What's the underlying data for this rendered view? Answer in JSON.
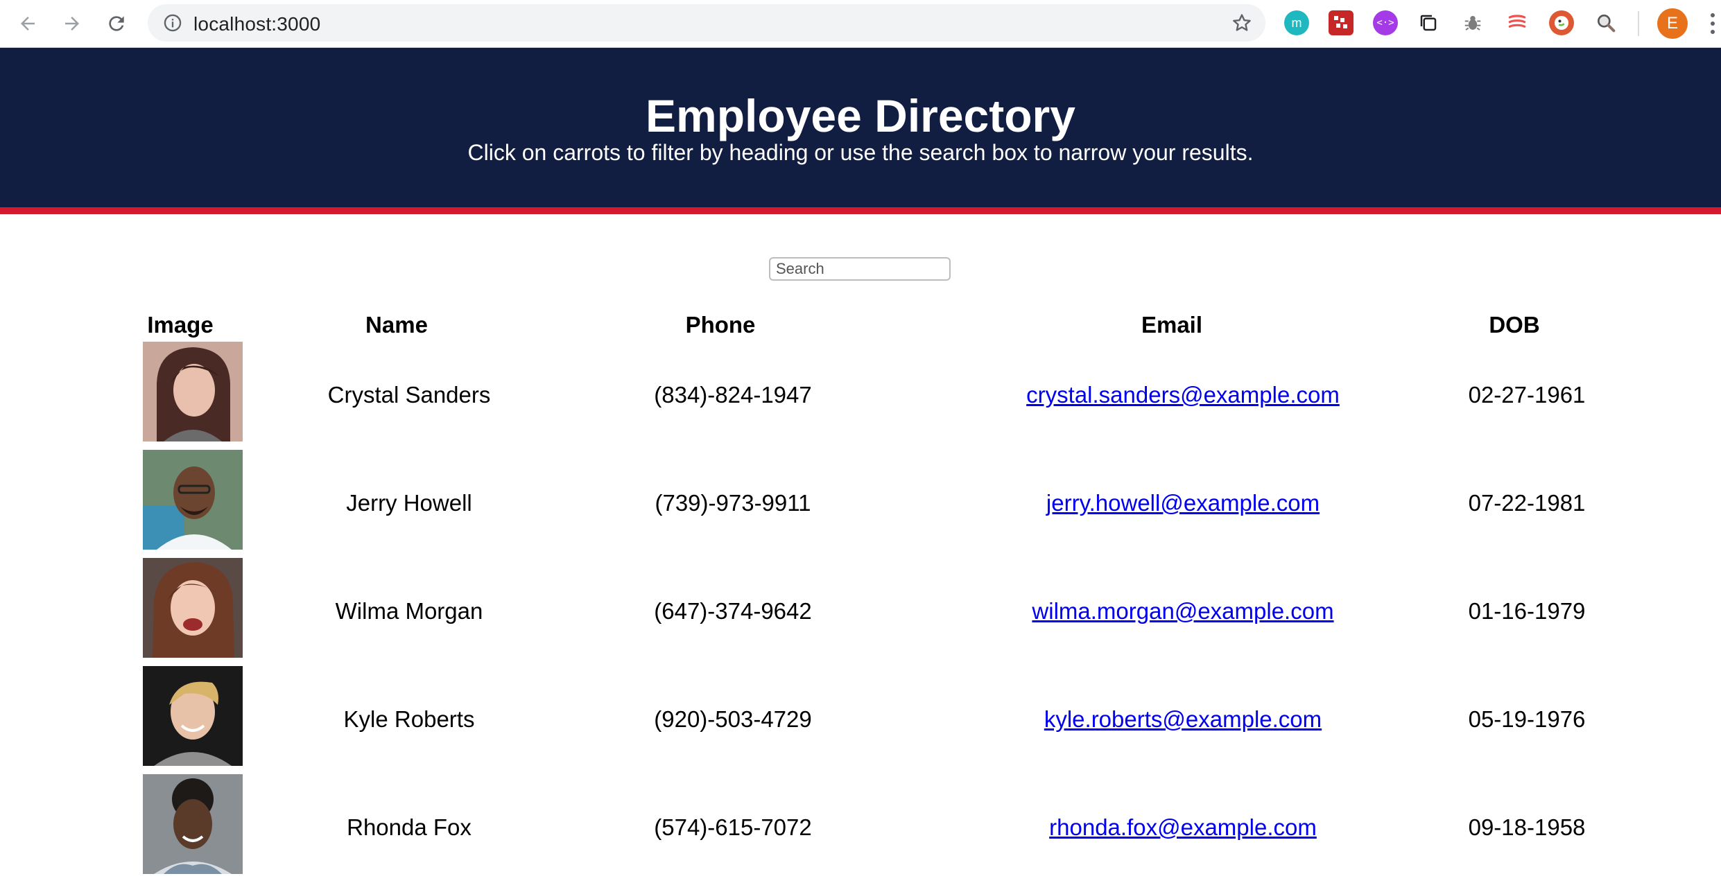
{
  "browser": {
    "url": "localhost:3000",
    "profile_initial": "E",
    "extensions": [
      {
        "name": "momentum-extension",
        "letter": "m",
        "color": "#1fb8c1"
      },
      {
        "name": "pixel-extension",
        "letter": "",
        "color": "#c62828"
      },
      {
        "name": "code-extension",
        "letter": "</>",
        "color": "#a53be6"
      },
      {
        "name": "copy-extension",
        "letter": "",
        "color": "#5f6368"
      },
      {
        "name": "bug-extension",
        "letter": "",
        "color": "#8a8a8a"
      },
      {
        "name": "css-extension",
        "letter": "",
        "color": "#ef5350"
      },
      {
        "name": "duckduckgo-extension",
        "letter": "",
        "color": "#de5833"
      },
      {
        "name": "inspect-extension",
        "letter": "",
        "color": "#888888"
      }
    ]
  },
  "header": {
    "title": "Employee Directory",
    "subtitle": "Click on carrots to filter by heading or use the search box to narrow your results.",
    "bg_color": "#111d41",
    "stripe_color": "#d4182d"
  },
  "search": {
    "placeholder": "Search",
    "value": ""
  },
  "table": {
    "headers": {
      "image": "Image",
      "name": "Name",
      "phone": "Phone",
      "email": "Email",
      "dob": "DOB"
    },
    "rows": [
      {
        "name": "Crystal Sanders",
        "phone": "(834)-824-1947",
        "email": "crystal.sanders@example.com",
        "dob": "02-27-1961"
      },
      {
        "name": "Jerry Howell",
        "phone": "(739)-973-9911",
        "email": "jerry.howell@example.com",
        "dob": "07-22-1981"
      },
      {
        "name": "Wilma Morgan",
        "phone": "(647)-374-9642",
        "email": "wilma.morgan@example.com",
        "dob": "01-16-1979"
      },
      {
        "name": "Kyle Roberts",
        "phone": "(920)-503-4729",
        "email": "kyle.roberts@example.com",
        "dob": "05-19-1976"
      },
      {
        "name": "Rhonda Fox",
        "phone": "(574)-615-7072",
        "email": "rhonda.fox@example.com",
        "dob": "09-18-1958"
      }
    ]
  }
}
